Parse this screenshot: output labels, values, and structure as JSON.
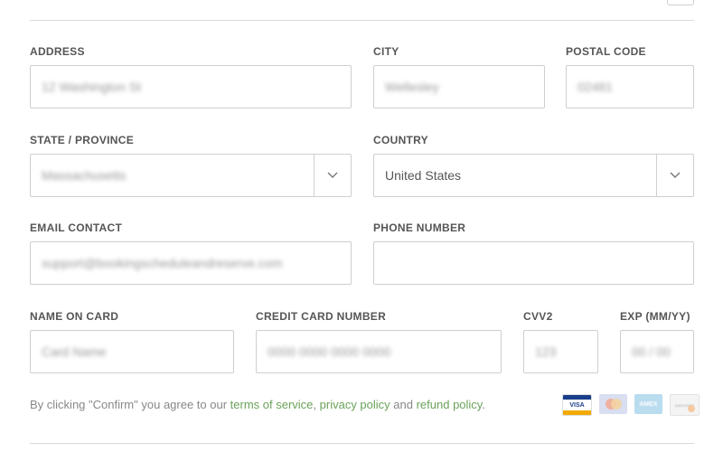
{
  "form": {
    "address": {
      "label": "ADDRESS",
      "value": "12 Washington St"
    },
    "city": {
      "label": "CITY",
      "value": "Wellesley"
    },
    "postal_code": {
      "label": "POSTAL CODE",
      "value": "02481"
    },
    "state": {
      "label": "STATE / PROVINCE",
      "value": "Massachusetts"
    },
    "country": {
      "label": "COUNTRY",
      "value": "United States"
    },
    "email": {
      "label": "EMAIL CONTACT",
      "value": "support@bookingscheduleandreserve.com"
    },
    "phone": {
      "label": "PHONE NUMBER",
      "value": ""
    },
    "name_on_card": {
      "label": "NAME ON CARD",
      "value": "Card Name"
    },
    "card_number": {
      "label": "CREDIT CARD NUMBER",
      "value": "0000 0000 0000 0000"
    },
    "cvv2": {
      "label": "CVV2",
      "value": "123"
    },
    "exp": {
      "label": "EXP (MM/YY)",
      "value": "00 / 00"
    }
  },
  "consent": {
    "prefix": "By clicking \"Confirm\" you agree to our ",
    "terms": "terms of service",
    "sep1": ", ",
    "privacy": "privacy policy",
    "sep2": " and ",
    "refund": "refund policy",
    "suffix": "."
  },
  "cards": [
    {
      "icon": "visa-card-icon",
      "text": "VISA"
    },
    {
      "icon": "mastercard-card-icon",
      "text": ""
    },
    {
      "icon": "amex-card-icon",
      "text": "AMEX"
    },
    {
      "icon": "discover-card-icon",
      "text": "DISCOVER"
    }
  ],
  "colors": {
    "link": "#6aa25a",
    "border": "#cfcfcf"
  }
}
